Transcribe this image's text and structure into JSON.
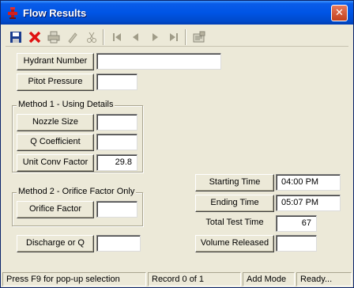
{
  "window": {
    "title": "Flow Results"
  },
  "title_bar": {
    "close_glyph": "✕"
  },
  "toolbar": {
    "icons": [
      "save-icon",
      "delete-icon",
      "print-icon",
      "edit-icon",
      "cut-icon",
      "first-record-icon",
      "previous-record-icon",
      "next-record-icon",
      "last-record-icon",
      "report-icon"
    ]
  },
  "fields": {
    "hydrant_number": {
      "label": "Hydrant Number",
      "value": ""
    },
    "pitot_pressure": {
      "label": "Pitot Pressure",
      "value": ""
    },
    "nozzle_size": {
      "label": "Nozzle Size",
      "value": ""
    },
    "q_coefficient": {
      "label": "Q Coefficient",
      "value": ""
    },
    "unit_conv_factor": {
      "label": "Unit Conv Factor",
      "value": "29.8"
    },
    "orifice_factor": {
      "label": "Orifice Factor",
      "value": ""
    },
    "discharge_or_q": {
      "label": "Discharge or Q",
      "value": ""
    },
    "starting_time": {
      "label": "Starting Time",
      "value": "04:00 PM"
    },
    "ending_time": {
      "label": "Ending Time",
      "value": "05:07 PM"
    },
    "total_test_time": {
      "label": "Total Test Time",
      "value": "67"
    },
    "volume_released": {
      "label": "Volume Released",
      "value": ""
    }
  },
  "groups": {
    "method1": "Method 1 - Using Details",
    "method2": "Method 2 - Orifice Factor Only"
  },
  "status": {
    "hint": "Press F9 for pop-up selection",
    "record": "Record 0 of 1",
    "mode": "Add Mode",
    "state": "Ready..."
  },
  "colors": {
    "title_bar": "#0055e5",
    "window_bg": "#ece9d8",
    "close_button": "#c2411d"
  }
}
